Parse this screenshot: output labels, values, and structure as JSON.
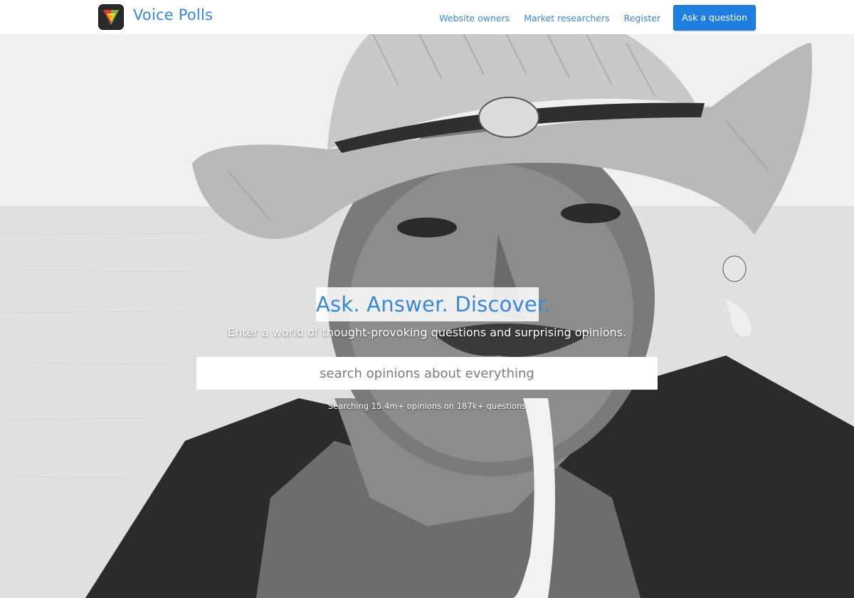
{
  "brand": {
    "name": "Voice Polls",
    "logo_icon": "voice-polls-triangle-logo"
  },
  "nav": {
    "items": [
      {
        "label": "Website owners"
      },
      {
        "label": "Market researchers"
      },
      {
        "label": "Register"
      }
    ],
    "cta_label": "Ask a question"
  },
  "hero": {
    "headline": "Ask. Answer. Discover.",
    "subhead": "Enter a world of thought-provoking questions and surprising opinions.",
    "search_placeholder": "search opinions about everything",
    "stats": "Searching 15.4m+ opinions on 187k+ questions",
    "background": "grayscale-photo-man-in-straw-hat"
  },
  "colors": {
    "accent": "#3a87d6",
    "cta": "#1f7fe0",
    "topbar": "#ffffff"
  }
}
